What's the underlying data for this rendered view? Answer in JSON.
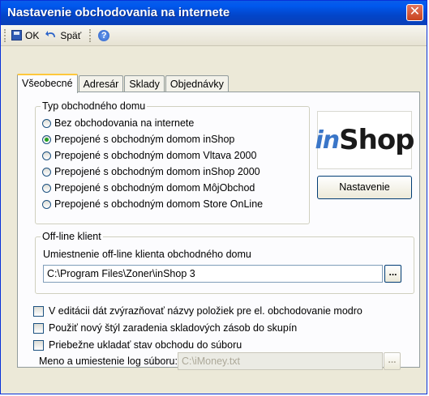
{
  "window": {
    "title": "Nastavenie obchodovania na internete",
    "close_glyph": "✕"
  },
  "toolbar": {
    "ok_label": "OK",
    "back_label": "Späť",
    "help_glyph": "?"
  },
  "tabs": [
    {
      "label": "Všeobecné",
      "active": true
    },
    {
      "label": "Adresár",
      "active": false
    },
    {
      "label": "Sklady",
      "active": false
    },
    {
      "label": "Objednávky",
      "active": false
    }
  ],
  "shop_type": {
    "label": "Typ obchodného domu",
    "options": [
      {
        "label": "Bez obchodovania na internete",
        "selected": false
      },
      {
        "label": "Prepojené s obchodným domom inShop",
        "selected": true
      },
      {
        "label": "Prepojené s obchodným domom Vltava 2000",
        "selected": false
      },
      {
        "label": "Prepojené s obchodným domom inShop 2000",
        "selected": false
      },
      {
        "label": "Prepojené s obchodným domom MôjObchod",
        "selected": false
      },
      {
        "label": "Prepojené s obchodným domom Store OnLine",
        "selected": false
      }
    ]
  },
  "logo": {
    "prefix": "in",
    "suffix": "Shop"
  },
  "settings_button": "Nastavenie",
  "offline": {
    "label": "Off-line klient",
    "location_label": "Umiestnenie off-line klienta obchodného domu",
    "path_value": "C:\\Program Files\\Zoner\\inShop 3",
    "browse_glyph": "..."
  },
  "options": [
    {
      "label": "V editácii dát zvýrazňovať názvy položiek pre el. obchodovanie modro",
      "checked": false
    },
    {
      "label": "Použiť nový štýl zaradenia skladových zásob do skupín",
      "checked": false
    },
    {
      "label": "Priebežne ukladať stav obchodu do súboru",
      "checked": false
    }
  ],
  "log": {
    "label": "Meno a umiestenie log súboru:",
    "value": "C:\\iMoney.txt",
    "browse_glyph": "..."
  },
  "colors": {
    "title_bar": "#0245c9",
    "close": "#c8421e",
    "tab_highlight": "#ffc83c",
    "selected_radio": "#21a121"
  },
  "icons": [
    "save-icon",
    "undo-icon",
    "help-icon",
    "close-icon"
  ]
}
